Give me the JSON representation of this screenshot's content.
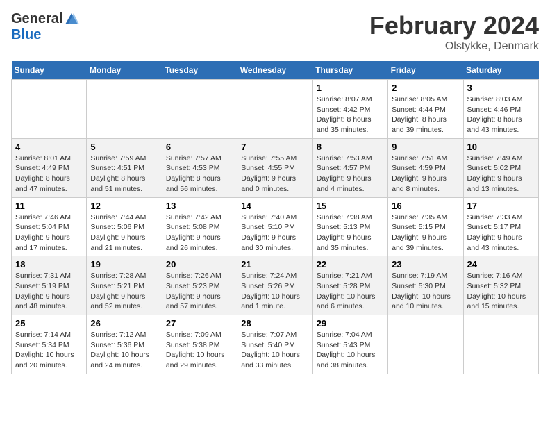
{
  "header": {
    "logo_general": "General",
    "logo_blue": "Blue",
    "month_title": "February 2024",
    "location": "Olstykke, Denmark"
  },
  "weekdays": [
    "Sunday",
    "Monday",
    "Tuesday",
    "Wednesday",
    "Thursday",
    "Friday",
    "Saturday"
  ],
  "weeks": [
    [
      {
        "day": "",
        "info": ""
      },
      {
        "day": "",
        "info": ""
      },
      {
        "day": "",
        "info": ""
      },
      {
        "day": "",
        "info": ""
      },
      {
        "day": "1",
        "info": "Sunrise: 8:07 AM\nSunset: 4:42 PM\nDaylight: 8 hours\nand 35 minutes."
      },
      {
        "day": "2",
        "info": "Sunrise: 8:05 AM\nSunset: 4:44 PM\nDaylight: 8 hours\nand 39 minutes."
      },
      {
        "day": "3",
        "info": "Sunrise: 8:03 AM\nSunset: 4:46 PM\nDaylight: 8 hours\nand 43 minutes."
      }
    ],
    [
      {
        "day": "4",
        "info": "Sunrise: 8:01 AM\nSunset: 4:49 PM\nDaylight: 8 hours\nand 47 minutes."
      },
      {
        "day": "5",
        "info": "Sunrise: 7:59 AM\nSunset: 4:51 PM\nDaylight: 8 hours\nand 51 minutes."
      },
      {
        "day": "6",
        "info": "Sunrise: 7:57 AM\nSunset: 4:53 PM\nDaylight: 8 hours\nand 56 minutes."
      },
      {
        "day": "7",
        "info": "Sunrise: 7:55 AM\nSunset: 4:55 PM\nDaylight: 9 hours\nand 0 minutes."
      },
      {
        "day": "8",
        "info": "Sunrise: 7:53 AM\nSunset: 4:57 PM\nDaylight: 9 hours\nand 4 minutes."
      },
      {
        "day": "9",
        "info": "Sunrise: 7:51 AM\nSunset: 4:59 PM\nDaylight: 9 hours\nand 8 minutes."
      },
      {
        "day": "10",
        "info": "Sunrise: 7:49 AM\nSunset: 5:02 PM\nDaylight: 9 hours\nand 13 minutes."
      }
    ],
    [
      {
        "day": "11",
        "info": "Sunrise: 7:46 AM\nSunset: 5:04 PM\nDaylight: 9 hours\nand 17 minutes."
      },
      {
        "day": "12",
        "info": "Sunrise: 7:44 AM\nSunset: 5:06 PM\nDaylight: 9 hours\nand 21 minutes."
      },
      {
        "day": "13",
        "info": "Sunrise: 7:42 AM\nSunset: 5:08 PM\nDaylight: 9 hours\nand 26 minutes."
      },
      {
        "day": "14",
        "info": "Sunrise: 7:40 AM\nSunset: 5:10 PM\nDaylight: 9 hours\nand 30 minutes."
      },
      {
        "day": "15",
        "info": "Sunrise: 7:38 AM\nSunset: 5:13 PM\nDaylight: 9 hours\nand 35 minutes."
      },
      {
        "day": "16",
        "info": "Sunrise: 7:35 AM\nSunset: 5:15 PM\nDaylight: 9 hours\nand 39 minutes."
      },
      {
        "day": "17",
        "info": "Sunrise: 7:33 AM\nSunset: 5:17 PM\nDaylight: 9 hours\nand 43 minutes."
      }
    ],
    [
      {
        "day": "18",
        "info": "Sunrise: 7:31 AM\nSunset: 5:19 PM\nDaylight: 9 hours\nand 48 minutes."
      },
      {
        "day": "19",
        "info": "Sunrise: 7:28 AM\nSunset: 5:21 PM\nDaylight: 9 hours\nand 52 minutes."
      },
      {
        "day": "20",
        "info": "Sunrise: 7:26 AM\nSunset: 5:23 PM\nDaylight: 9 hours\nand 57 minutes."
      },
      {
        "day": "21",
        "info": "Sunrise: 7:24 AM\nSunset: 5:26 PM\nDaylight: 10 hours\nand 1 minute."
      },
      {
        "day": "22",
        "info": "Sunrise: 7:21 AM\nSunset: 5:28 PM\nDaylight: 10 hours\nand 6 minutes."
      },
      {
        "day": "23",
        "info": "Sunrise: 7:19 AM\nSunset: 5:30 PM\nDaylight: 10 hours\nand 10 minutes."
      },
      {
        "day": "24",
        "info": "Sunrise: 7:16 AM\nSunset: 5:32 PM\nDaylight: 10 hours\nand 15 minutes."
      }
    ],
    [
      {
        "day": "25",
        "info": "Sunrise: 7:14 AM\nSunset: 5:34 PM\nDaylight: 10 hours\nand 20 minutes."
      },
      {
        "day": "26",
        "info": "Sunrise: 7:12 AM\nSunset: 5:36 PM\nDaylight: 10 hours\nand 24 minutes."
      },
      {
        "day": "27",
        "info": "Sunrise: 7:09 AM\nSunset: 5:38 PM\nDaylight: 10 hours\nand 29 minutes."
      },
      {
        "day": "28",
        "info": "Sunrise: 7:07 AM\nSunset: 5:40 PM\nDaylight: 10 hours\nand 33 minutes."
      },
      {
        "day": "29",
        "info": "Sunrise: 7:04 AM\nSunset: 5:43 PM\nDaylight: 10 hours\nand 38 minutes."
      },
      {
        "day": "",
        "info": ""
      },
      {
        "day": "",
        "info": ""
      }
    ]
  ]
}
